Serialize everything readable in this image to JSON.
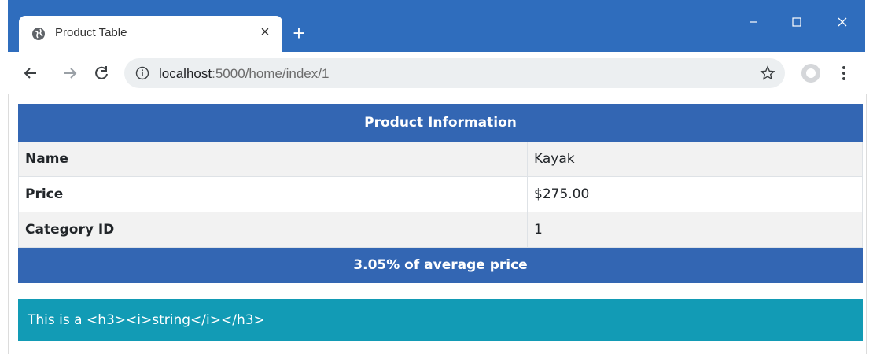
{
  "window": {
    "tab_title": "Product Table",
    "tab_close": "×",
    "new_tab": "+"
  },
  "toolbar": {
    "url_host": "localhost",
    "url_path": ":5000/home/index/1"
  },
  "table": {
    "header": "Product Information",
    "rows": [
      {
        "label": "Name",
        "value": "Kayak"
      },
      {
        "label": "Price",
        "value": "$275.00"
      },
      {
        "label": "Category ID",
        "value": "1"
      }
    ],
    "footer": "3.05% of average price"
  },
  "banner": {
    "text": "This is a <h3><i>string</i></h3>"
  },
  "colors": {
    "titlebar": "#2f6dbd",
    "table_header": "#3366b3",
    "banner": "#129bb5"
  },
  "icons": [
    "globe-icon",
    "close-icon",
    "plus-icon",
    "minimize-icon",
    "maximize-icon",
    "window-close-icon",
    "back-arrow-icon",
    "forward-arrow-icon",
    "reload-icon",
    "info-icon",
    "star-icon",
    "profile-icon",
    "kebab-menu-icon"
  ]
}
